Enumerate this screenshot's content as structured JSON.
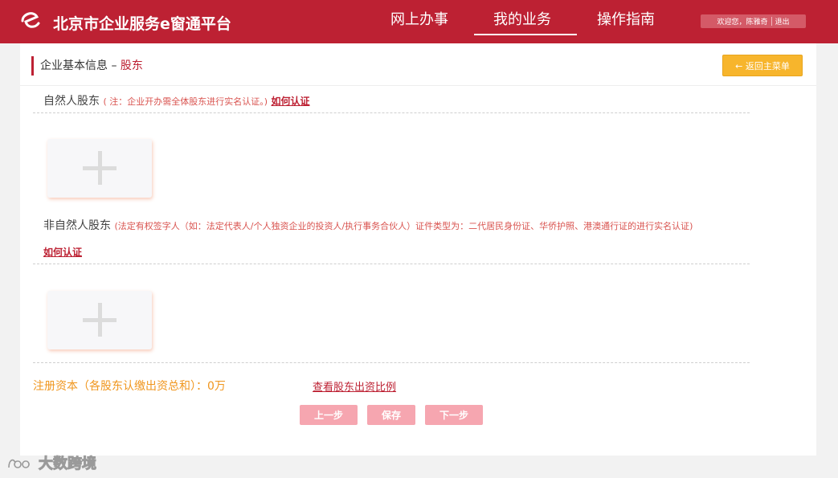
{
  "header": {
    "brand": "北京市企业服务e窗通平台",
    "logo_glyph": "e",
    "nav": [
      "网上办事",
      "我的业务",
      "操作指南"
    ],
    "active_nav": "我的业务",
    "user_greeting": "欢迎您，陈雅奇",
    "logout": "退出"
  },
  "page": {
    "breadcrumb_parent": "企业基本信息 –",
    "breadcrumb_current": "股东",
    "back_button": "← 返回主菜单"
  },
  "natural": {
    "title": "自然人股东",
    "note": "( 注：企业开办需全体股东进行实名认证。)",
    "how_link": "如何认证"
  },
  "nonnatural": {
    "title": "非自然人股东",
    "note": "(法定有权签字人（如：法定代表人/个人独资企业的投资人/执行事务合伙人）证件类型为：二代居民身份证、华侨护照、港澳通行证的进行实名认证)",
    "how_link": "如何认证"
  },
  "capital": {
    "text": "注册资本（各股东认缴出资总和）：0万",
    "ratio_link": "查看股东出资比例"
  },
  "buttons": {
    "prev": "上一步",
    "save": "保存",
    "next": "下一步"
  },
  "watermark": "大数跨境",
  "colors": {
    "brand_red": "#bd2133",
    "accent_orange": "#f7b52c",
    "capital_orange": "#f0961e",
    "button_pink": "#f6a6b0"
  }
}
